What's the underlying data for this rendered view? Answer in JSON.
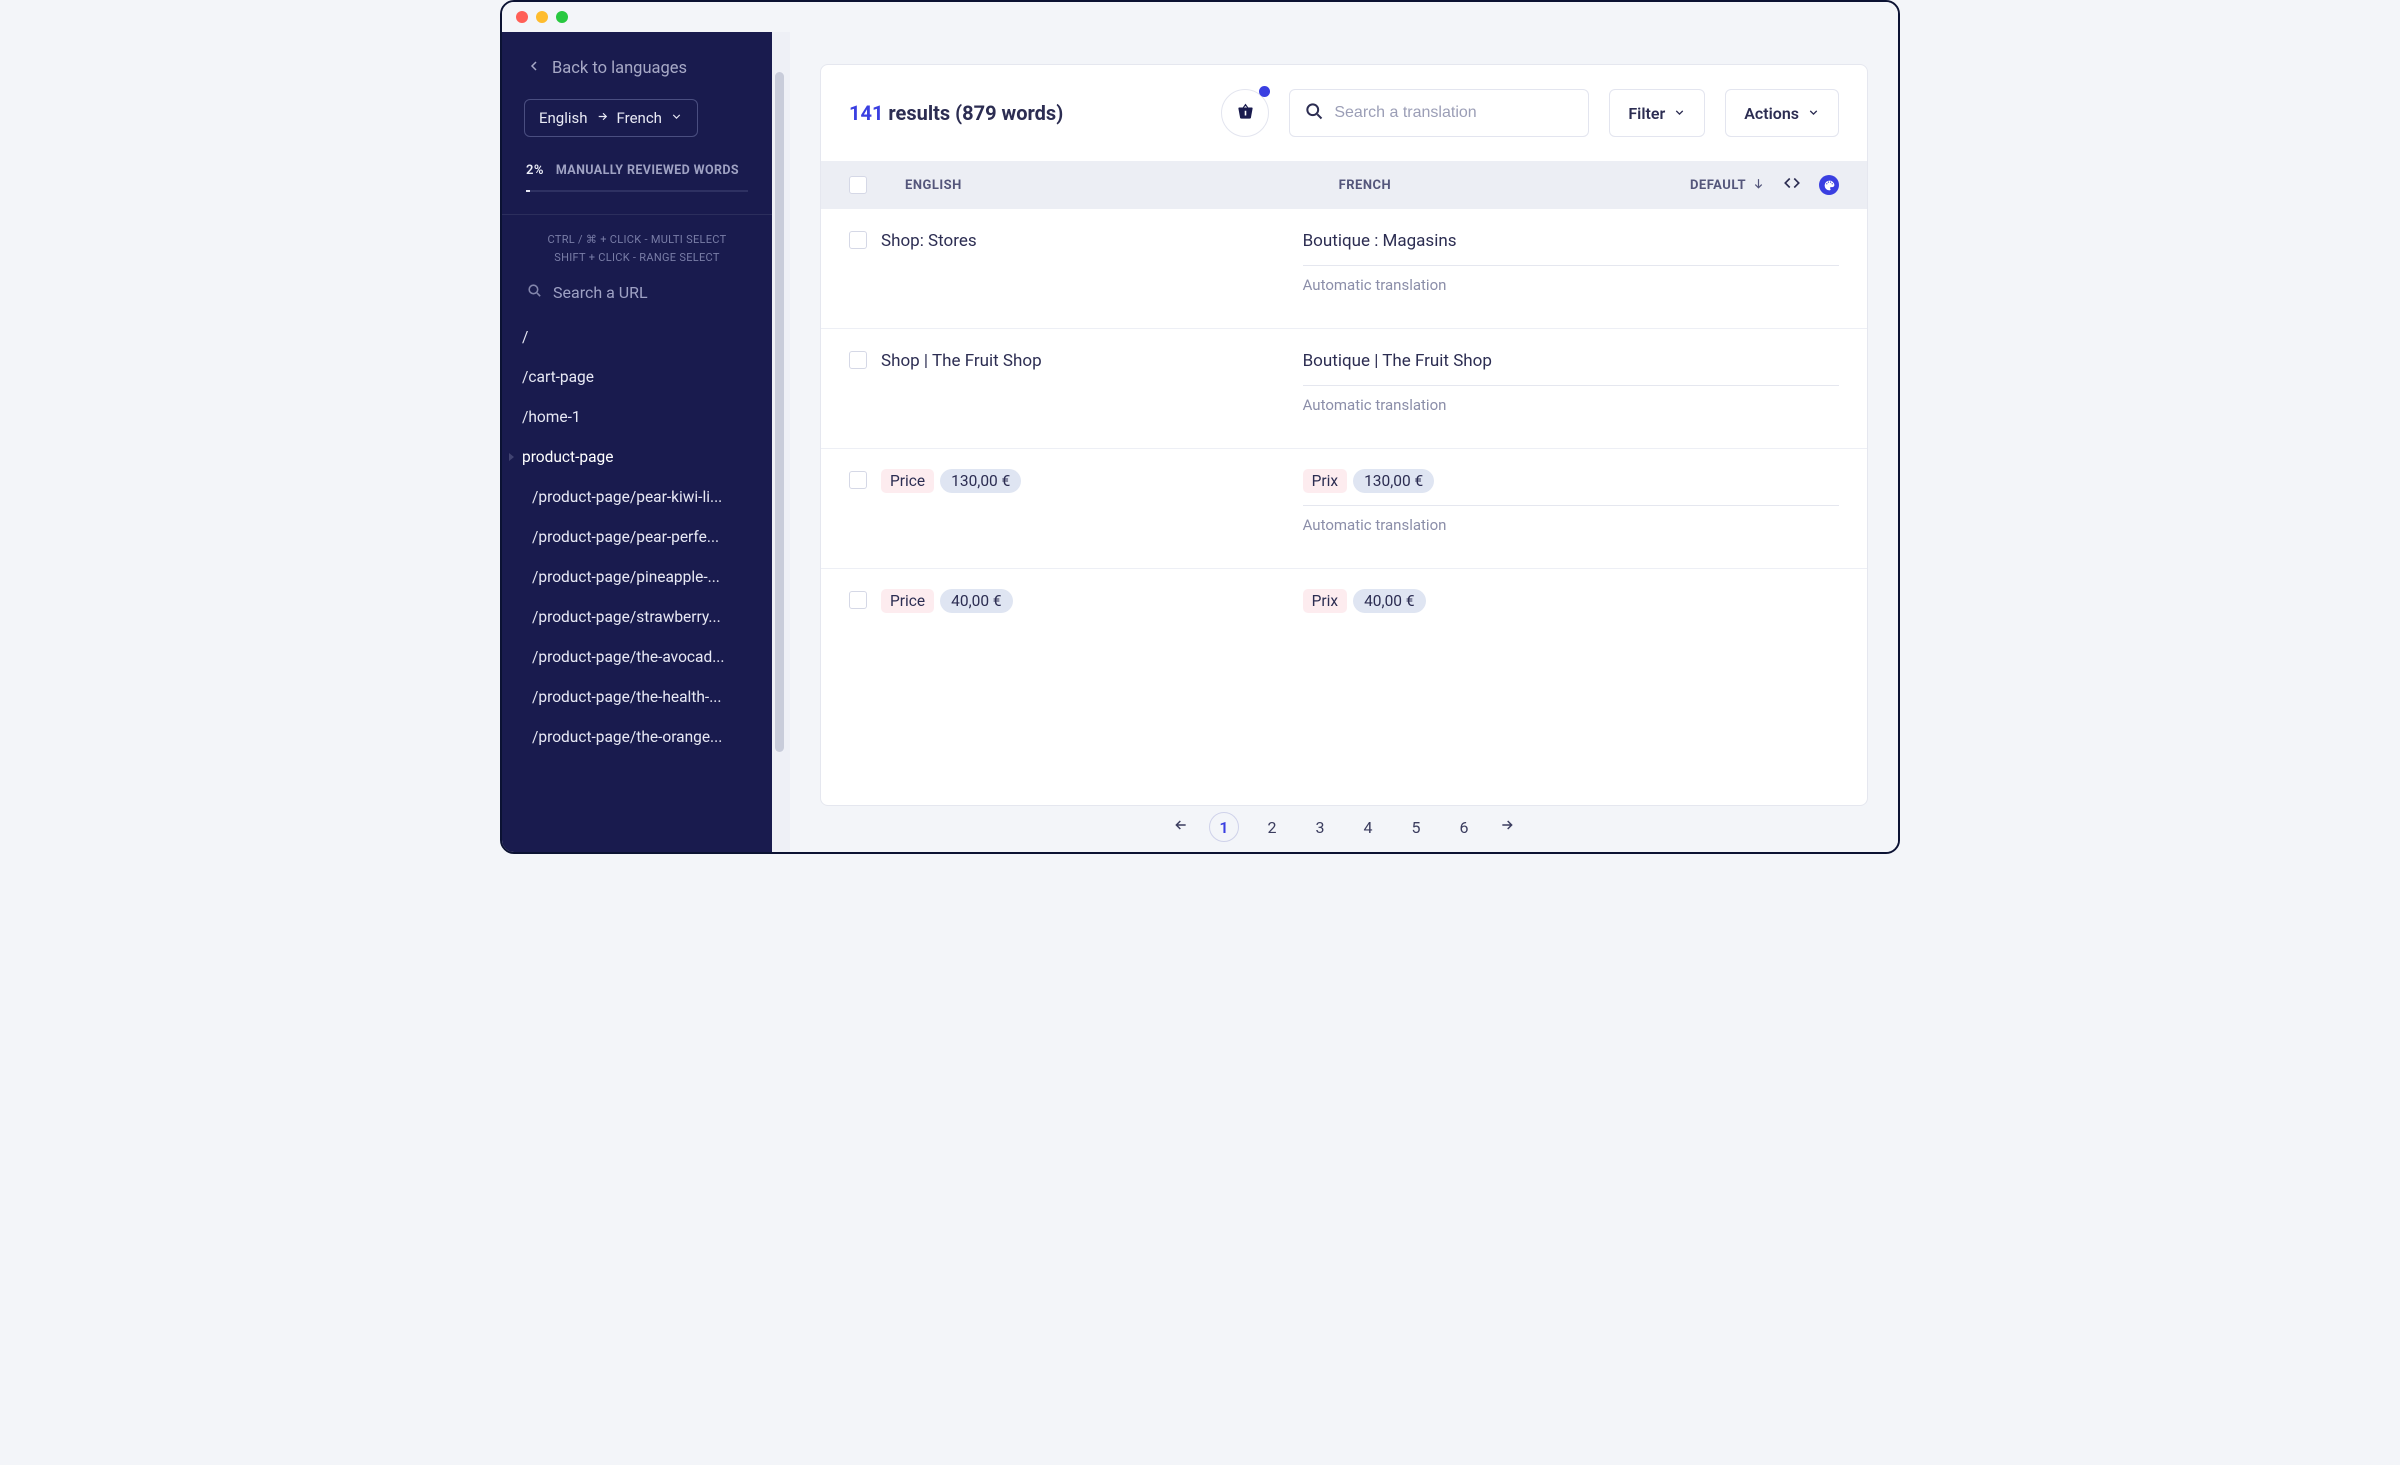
{
  "sidebar": {
    "back_label": "Back to languages",
    "lang_from": "English",
    "lang_to": "French",
    "review_pct": "2%",
    "review_label": "MANUALLY REVIEWED WORDS",
    "hint1": "CTRL / ⌘ + CLICK - MULTI SELECT",
    "hint2": "SHIFT + CLICK - RANGE SELECT",
    "search_placeholder": "Search a URL",
    "urls": [
      "/",
      "/cart-page",
      "/home-1",
      "product-page",
      "/product-page/pear-kiwi-li...",
      "/product-page/pear-perfe...",
      "/product-page/pineapple-...",
      "/product-page/strawberry...",
      "/product-page/the-avocad...",
      "/product-page/the-health-...",
      "/product-page/the-orange..."
    ],
    "active_index": 3
  },
  "toolbar": {
    "count": "141",
    "results_label": "results",
    "words_label": "(879 words)",
    "search_placeholder": "Search a translation",
    "filter_label": "Filter",
    "actions_label": "Actions"
  },
  "columns": {
    "english": "ENGLISH",
    "french": "FRENCH",
    "default": "DEFAULT"
  },
  "auto_label": "Automatic translation",
  "rows": [
    {
      "en": "Shop: Stores",
      "fr": "Boutique : Magasins",
      "chip": false
    },
    {
      "en": "Shop | The Fruit Shop",
      "fr": "Boutique | The Fruit Shop",
      "chip": false
    },
    {
      "en_label": "Price",
      "en_value": "130,00 €",
      "fr_label": "Prix",
      "fr_value": "130,00 €",
      "chip": true
    },
    {
      "en_label": "Price",
      "en_value": "40,00 €",
      "fr_label": "Prix",
      "fr_value": "40,00 €",
      "chip": true
    }
  ],
  "pagination": {
    "pages": [
      "1",
      "2",
      "3",
      "4",
      "5",
      "6"
    ],
    "active": 0
  }
}
